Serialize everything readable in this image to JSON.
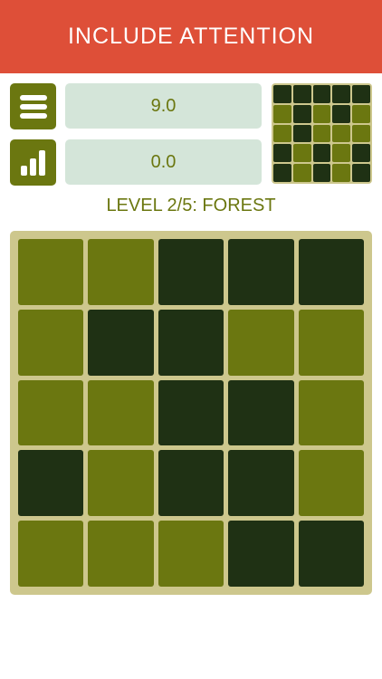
{
  "header": {
    "title": "INCLUDE ATTENTION"
  },
  "controls": {
    "menu_icon": "menu-icon",
    "stats_icon": "bar-chart-icon",
    "score_value": "9.0",
    "secondary_value": "0.0"
  },
  "level": {
    "label": "LEVEL 2/5: FOREST"
  },
  "colors": {
    "header_bg": "#de4f38",
    "light_tile": "#6b7710",
    "dark_tile": "#1f3114",
    "board_bg": "#cdc78d",
    "field_bg": "#d4e5d9"
  },
  "preview_grid": [
    [
      1,
      1,
      1,
      1,
      1
    ],
    [
      0,
      1,
      0,
      1,
      0
    ],
    [
      0,
      1,
      0,
      0,
      0
    ],
    [
      1,
      0,
      1,
      0,
      1
    ],
    [
      1,
      0,
      1,
      0,
      1
    ]
  ],
  "board_grid": [
    [
      0,
      0,
      1,
      1,
      1
    ],
    [
      0,
      1,
      1,
      0,
      0
    ],
    [
      0,
      0,
      1,
      1,
      0
    ],
    [
      1,
      0,
      1,
      1,
      0
    ],
    [
      0,
      0,
      0,
      1,
      1
    ]
  ]
}
